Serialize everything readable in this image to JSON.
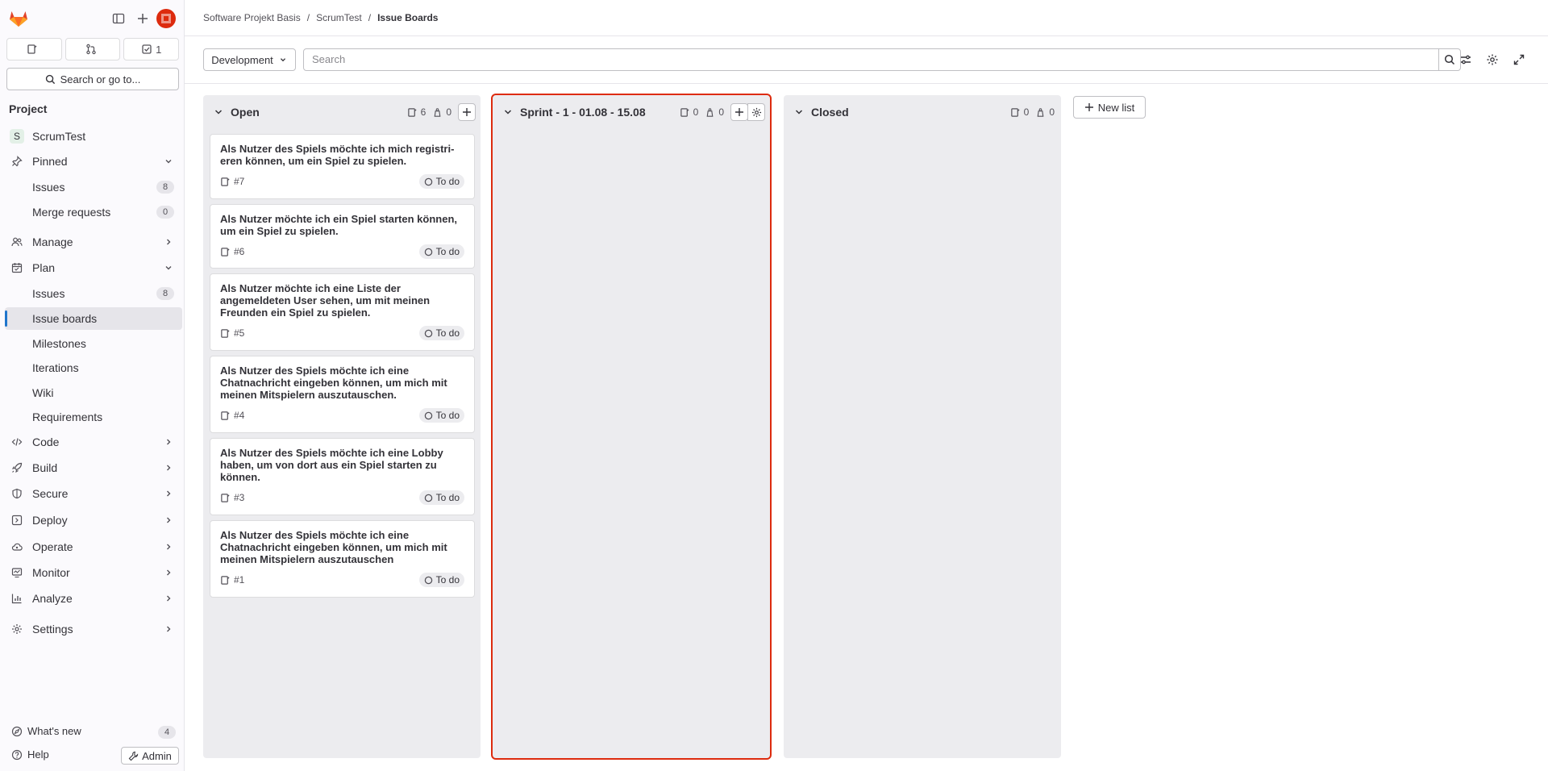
{
  "sidebar": {
    "tabs": [
      {
        "icon": "issues-icon",
        "label": ""
      },
      {
        "icon": "merge-request-icon",
        "label": ""
      },
      {
        "icon": "todo-icon",
        "label": "1"
      }
    ],
    "search_label": "Search or go to...",
    "section_title": "Project",
    "project": {
      "initial": "S",
      "name": "ScrumTest"
    },
    "pinned": {
      "label": "Pinned",
      "items": [
        {
          "label": "Issues",
          "count": "8"
        },
        {
          "label": "Merge requests",
          "count": "0"
        }
      ]
    },
    "manage": "Manage",
    "plan": {
      "label": "Plan",
      "items": [
        {
          "label": "Issues",
          "count": "8"
        },
        {
          "label": "Issue boards"
        },
        {
          "label": "Milestones"
        },
        {
          "label": "Iterations"
        },
        {
          "label": "Wiki"
        },
        {
          "label": "Requirements"
        }
      ]
    },
    "groups": [
      "Code",
      "Build",
      "Secure",
      "Deploy",
      "Operate",
      "Monitor",
      "Analyze",
      "Settings"
    ],
    "whats_new": {
      "label": "What's new",
      "count": "4"
    },
    "help": "Help",
    "admin": "Admin"
  },
  "breadcrumb": [
    "Software Projekt Basis",
    "ScrumTest",
    "Issue Boards"
  ],
  "board_selector": "Development",
  "search": {
    "placeholder": "Search"
  },
  "new_list_label": "New list",
  "columns": [
    {
      "title": "Open",
      "issue_count": "6",
      "weight": "0",
      "cards": [
        {
          "title": "Als Nutzer des Spiels möchte ich mich registri-eren können, um ein Spiel zu spielen.",
          "number": "#7",
          "status": "To do"
        },
        {
          "title": "Als Nutzer möchte ich ein Spiel starten können, um ein Spiel zu spielen.",
          "number": "#6",
          "status": "To do"
        },
        {
          "title": "Als Nutzer möchte ich eine Liste der angemeldeten User sehen, um mit meinen Freunden ein Spiel zu spielen.",
          "number": "#5",
          "status": "To do"
        },
        {
          "title": "Als Nutzer des Spiels möchte ich eine Chatnachricht eingeben können, um mich mit meinen Mitspielern auszutauschen.",
          "number": "#4",
          "status": "To do"
        },
        {
          "title": "Als Nutzer des Spiels möchte ich eine Lobby haben, um von dort aus ein Spiel starten zu können.",
          "number": "#3",
          "status": "To do"
        },
        {
          "title": "Als Nutzer des Spiels möchte ich eine Chatnachricht eingeben können, um mich mit meinen Mitspielern auszutauschen",
          "number": "#1",
          "status": "To do"
        }
      ]
    },
    {
      "title": "Sprint - 1 - 01.08 - 15.08",
      "issue_count": "0",
      "weight": "0",
      "cards": []
    },
    {
      "title": "Closed",
      "issue_count": "0",
      "weight": "0",
      "cards": []
    }
  ]
}
